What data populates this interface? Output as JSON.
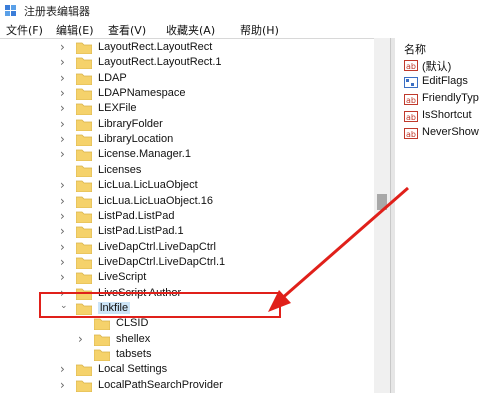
{
  "window": {
    "title": "注册表编辑器"
  },
  "menu": [
    "文件(F)",
    "编辑(E)",
    "查看(V)",
    "收藏夹(A)",
    "帮助(H)"
  ],
  "tree": [
    {
      "label": "LayoutRect.LayoutRect",
      "expander": ">",
      "indent": 0
    },
    {
      "label": "LayoutRect.LayoutRect.1",
      "expander": ">",
      "indent": 0
    },
    {
      "label": "LDAP",
      "expander": ">",
      "indent": 0
    },
    {
      "label": "LDAPNamespace",
      "expander": ">",
      "indent": 0
    },
    {
      "label": "LEXFile",
      "expander": ">",
      "indent": 0
    },
    {
      "label": "LibraryFolder",
      "expander": ">",
      "indent": 0
    },
    {
      "label": "LibraryLocation",
      "expander": ">",
      "indent": 0
    },
    {
      "label": "License.Manager.1",
      "expander": ">",
      "indent": 0
    },
    {
      "label": "Licenses",
      "expander": "",
      "indent": 0
    },
    {
      "label": "LicLua.LicLuaObject",
      "expander": ">",
      "indent": 0
    },
    {
      "label": "LicLua.LicLuaObject.16",
      "expander": ">",
      "indent": 0
    },
    {
      "label": "ListPad.ListPad",
      "expander": ">",
      "indent": 0
    },
    {
      "label": "ListPad.ListPad.1",
      "expander": ">",
      "indent": 0
    },
    {
      "label": "LiveDapCtrl.LiveDapCtrl",
      "expander": ">",
      "indent": 0
    },
    {
      "label": "LiveDapCtrl.LiveDapCtrl.1",
      "expander": ">",
      "indent": 0
    },
    {
      "label": "LiveScript",
      "expander": ">",
      "indent": 0
    },
    {
      "label": "LiveScript Author",
      "expander": ">",
      "indent": 0
    },
    {
      "label": "lnkfile",
      "expander": "v",
      "indent": 0,
      "selected": true
    },
    {
      "label": "CLSID",
      "expander": "",
      "indent": 1
    },
    {
      "label": "shellex",
      "expander": ">",
      "indent": 1
    },
    {
      "label": "tabsets",
      "expander": "",
      "indent": 1
    },
    {
      "label": "Local Settings",
      "expander": ">",
      "indent": 0
    },
    {
      "label": "LocalPathSearchProvider",
      "expander": ">",
      "indent": 0
    }
  ],
  "values": {
    "header": "名称",
    "items": [
      {
        "name": "(默认)",
        "icon": "string-value-icon"
      },
      {
        "name": "EditFlags",
        "icon": "binary-value-icon"
      },
      {
        "name": "FriendlyTyp",
        "icon": "string-value-icon"
      },
      {
        "name": "IsShortcut",
        "icon": "string-value-icon"
      },
      {
        "name": "NeverShow",
        "icon": "string-value-icon"
      }
    ]
  },
  "colors": {
    "annotation": "#e0201a",
    "folder": "#f5d26b",
    "selection": "#cce4f7"
  }
}
